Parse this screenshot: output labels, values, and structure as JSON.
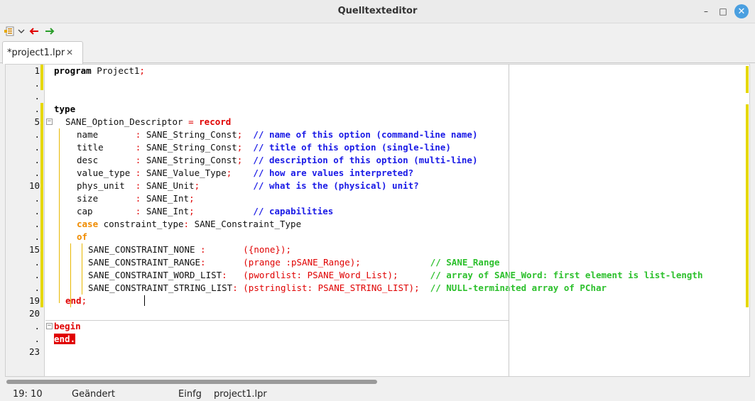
{
  "window": {
    "title": "Quelltexteditor",
    "minimize_glyph": "–",
    "maximize_glyph": "□",
    "close_glyph": "✕"
  },
  "toolbar": {
    "items": [
      "jump-list-icon",
      "chevron-down-icon",
      "back-arrow-icon",
      "forward-arrow-icon"
    ],
    "back_color": "#e00000",
    "forward_color": "#2a9d2a"
  },
  "tabs": [
    {
      "label": "*project1.lpr",
      "close_glyph": "✕"
    }
  ],
  "gutter": {
    "line_numbers": [
      "1",
      ".",
      ".",
      ".",
      "5",
      ".",
      ".",
      ".",
      ".",
      "10",
      ".",
      ".",
      ".",
      ".",
      "15",
      ".",
      ".",
      ".",
      "19",
      "20",
      ".",
      ".",
      "23"
    ]
  },
  "code": {
    "l1": [
      "program",
      " Project1",
      ";"
    ],
    "l4": "type",
    "l5": [
      "SANE_Option_Descriptor ",
      "=",
      " ",
      "record"
    ],
    "l6": [
      "name       ",
      ":",
      " SANE_String_Const",
      ";",
      "  ",
      "// name of this option (command-line name)"
    ],
    "l7": [
      "title      ",
      ":",
      " SANE_String_Const",
      ";",
      "  ",
      "// title of this option (single-line)"
    ],
    "l8": [
      "desc       ",
      ":",
      " SANE_String_Const",
      ";",
      "  ",
      "// description of this option (multi-line)"
    ],
    "l9": [
      "value_type ",
      ":",
      " SANE_Value_Type",
      ";",
      "    ",
      "// how are values interpreted?"
    ],
    "l10": [
      "phys_unit  ",
      ":",
      " SANE_Unit",
      ";",
      "          ",
      "// what is the (physical) unit?"
    ],
    "l11": [
      "size       ",
      ":",
      " SANE_Int",
      ";"
    ],
    "l12": [
      "cap        ",
      ":",
      " SANE_Int",
      ";",
      "           ",
      "// capabilities"
    ],
    "l13": [
      "case",
      " constraint_type",
      ":",
      " SANE_Constraint_Type"
    ],
    "l14": "of",
    "l15": [
      "SANE_CONSTRAINT_NONE ",
      ":",
      "       ",
      "({none});"
    ],
    "l16": [
      "SANE_CONSTRAINT_RANGE",
      ":",
      "       ",
      "(prange :pSANE_Range);",
      "             ",
      "// SANE_Range"
    ],
    "l17": [
      "SANE_CONSTRAINT_WORD_LIST",
      ":",
      "   ",
      "(pwordlist: PSANE_Word_List);",
      "      ",
      "// array of SANE_Word: first element is list-length"
    ],
    "l18": [
      "SANE_CONSTRAINT_STRING_LIST",
      ":",
      " ",
      "(pstringlist: PSANE_STRING_LIST);",
      "  ",
      "// NULL-terminated array of PChar"
    ],
    "l19": [
      "end",
      ";"
    ],
    "l21": "begin",
    "l22": "end."
  },
  "status": {
    "position": "19: 10",
    "modified": "Geändert",
    "mode": "Einfg",
    "file": "project1.lpr"
  }
}
